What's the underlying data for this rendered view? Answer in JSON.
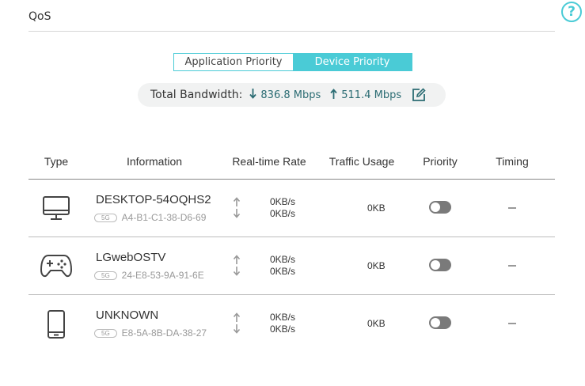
{
  "page": {
    "title": "QoS",
    "help_icon": "help-icon",
    "help_glyph": "?"
  },
  "tabs": [
    {
      "label": "Application Priority",
      "active": false
    },
    {
      "label": "Device Priority",
      "active": true
    }
  ],
  "bandwidth": {
    "label": "Total Bandwidth:",
    "download": "836.8 Mbps",
    "upload": "511.4 Mbps",
    "edit_icon": "edit-icon"
  },
  "table": {
    "headers": {
      "type": "Type",
      "information": "Information",
      "rate": "Real-time Rate",
      "usage": "Traffic Usage",
      "priority": "Priority",
      "timing": "Timing"
    },
    "rows": [
      {
        "icon": "desktop-icon",
        "name": "DESKTOP-54OQHS2",
        "band": "5G",
        "mac": "A4-B1-C1-38-D6-69",
        "up_rate": "0KB/s",
        "down_rate": "0KB/s",
        "usage": "0KB",
        "priority": false
      },
      {
        "icon": "gamepad-icon",
        "name": "LGwebOSTV",
        "band": "5G",
        "mac": "24-E8-53-9A-91-6E",
        "up_rate": "0KB/s",
        "down_rate": "0KB/s",
        "usage": "0KB",
        "priority": false
      },
      {
        "icon": "phone-icon",
        "name": "UNKNOWN",
        "band": "5G",
        "mac": "E8-5A-8B-DA-38-27",
        "up_rate": "0KB/s",
        "down_rate": "0KB/s",
        "usage": "0KB",
        "priority": false
      }
    ]
  },
  "colors": {
    "accent": "#4acbd6",
    "toggle_off": "#7a7a7a",
    "bandwidth_text": "#2b6c73"
  }
}
